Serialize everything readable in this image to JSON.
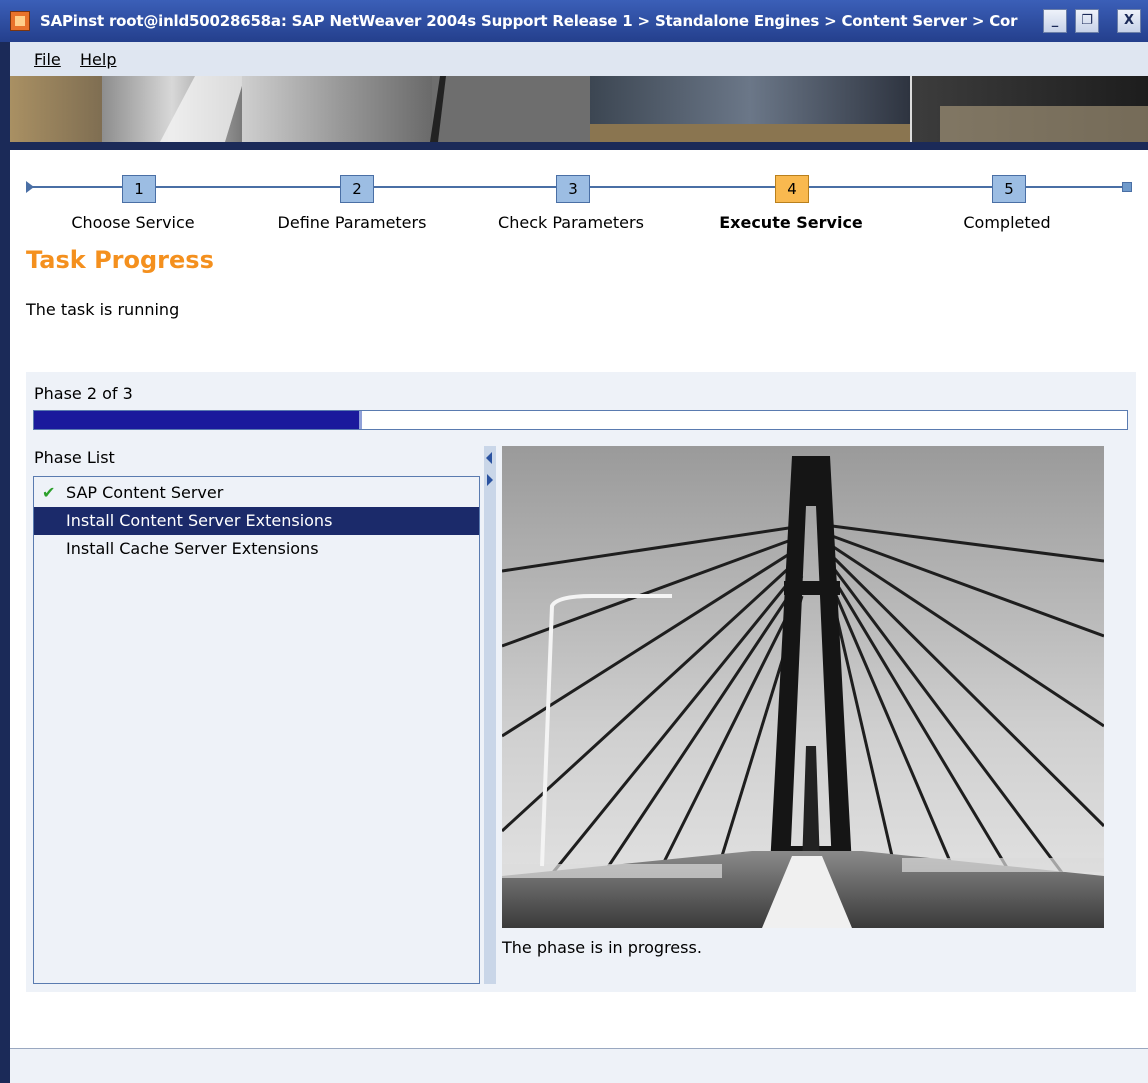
{
  "window": {
    "title": "SAPinst root@inld50028658a: SAP NetWeaver 2004s Support Release 1 > Standalone Engines > Content Server > Cor",
    "minimize_label": "_",
    "maximize_label": "❐",
    "close_label": "X"
  },
  "menu": {
    "file_label": "File",
    "help_label": "Help"
  },
  "roadmap": {
    "steps": [
      {
        "number": "1",
        "label": "Choose Service",
        "active": false
      },
      {
        "number": "2",
        "label": "Define Parameters",
        "active": false
      },
      {
        "number": "3",
        "label": "Check Parameters",
        "active": false
      },
      {
        "number": "4",
        "label": "Execute Service",
        "active": true
      },
      {
        "number": "5",
        "label": "Completed",
        "active": false
      }
    ]
  },
  "task": {
    "title": "Task Progress",
    "status": "The task is running"
  },
  "phase": {
    "count_text": "Phase 2 of 3",
    "progress_fraction": 0.3,
    "list_label": "Phase List",
    "items": [
      {
        "label": "SAP Content Server",
        "state": "done",
        "icon": "check-icon"
      },
      {
        "label": "Install Content Server Extensions",
        "state": "selected"
      },
      {
        "label": "Install Cache Server Extensions",
        "state": "pending"
      }
    ],
    "message": "The phase is in progress."
  },
  "colors": {
    "accent_orange": "#f4901e",
    "selection_blue": "#1b2a6a",
    "progress_blue": "#1a1a9c",
    "step_active": "#f9b94f",
    "step_default": "#9cbde3"
  }
}
